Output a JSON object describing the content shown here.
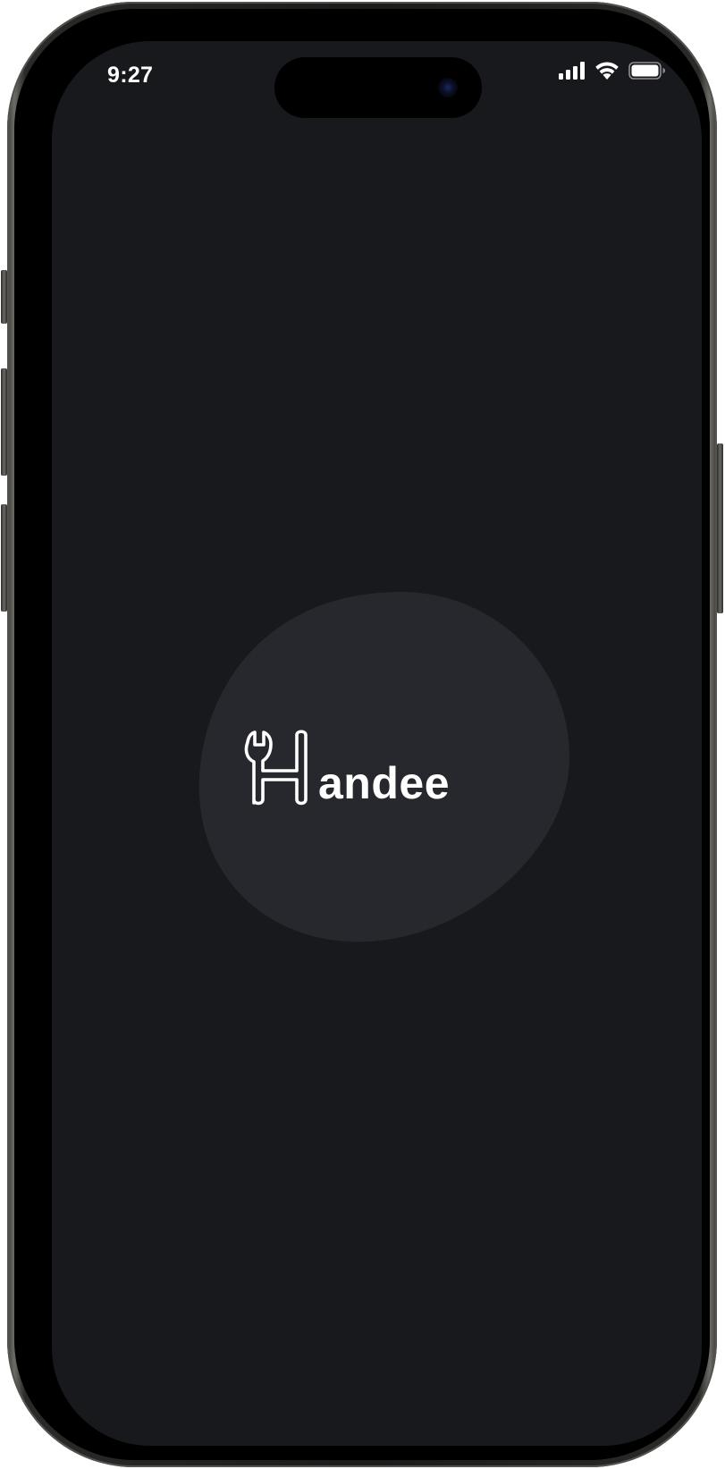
{
  "status_bar": {
    "time": "9:27",
    "icons": [
      "cellular-signal-icon",
      "wifi-icon",
      "battery-icon"
    ]
  },
  "splash": {
    "logo_text": "andee",
    "logo_icon": "wrench-h-icon"
  },
  "colors": {
    "screen_background": "#18191d",
    "blob": "#27282d",
    "logo": "#ffffff"
  }
}
